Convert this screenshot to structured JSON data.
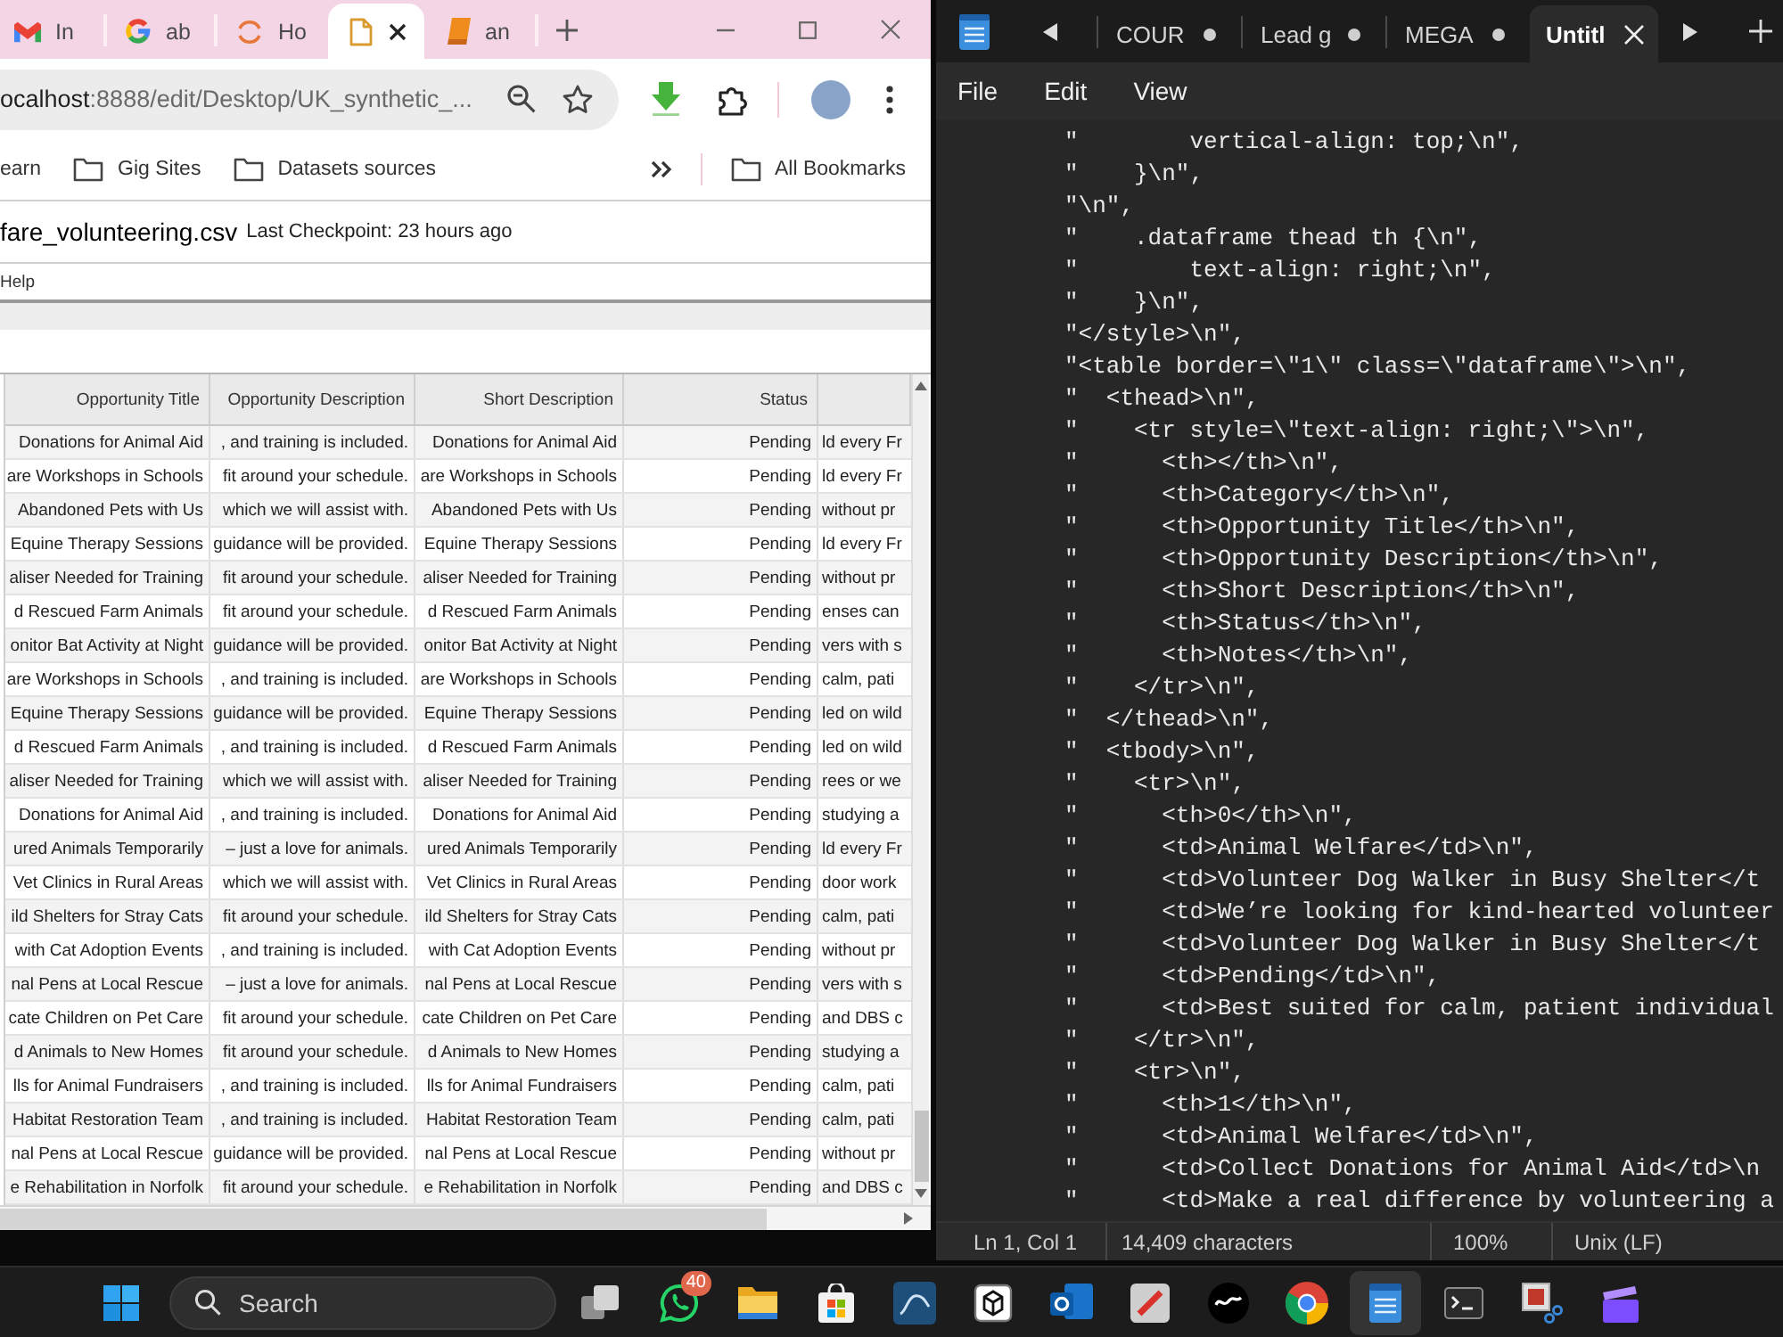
{
  "browser": {
    "tabs": [
      {
        "kind": "mail",
        "label": "In",
        "selected": false
      },
      {
        "kind": "segments",
        "label": "ab",
        "selected": false
      },
      {
        "kind": "ring",
        "label": "Ho",
        "selected": false
      },
      {
        "kind": "file",
        "selected": true
      },
      {
        "kind": "book",
        "label": "an",
        "selected": false
      }
    ],
    "url": {
      "host": "ocalhost",
      "path": ":8888/edit/Desktop/UK_synthetic_..."
    },
    "bookmarks": [
      {
        "kind": "plain",
        "label": "earn"
      },
      {
        "kind": "folder",
        "label": "Gig Sites"
      },
      {
        "kind": "folder",
        "label": "Datasets sources"
      }
    ],
    "all_bookmarks": "All Bookmarks"
  },
  "notebook": {
    "filename": "fare_volunteering.csv",
    "checkpoint": "Last Checkpoint: 23 hours ago",
    "menu": [
      "Help"
    ]
  },
  "table": {
    "columns": [
      "Opportunity Title",
      "Opportunity Description",
      "Short Description",
      "Status"
    ],
    "rows": [
      [
        "Donations for Animal Aid",
        ", and training is included.",
        "Donations for Animal Aid",
        "Pending",
        "ld every Fr"
      ],
      [
        "are Workshops in Schools",
        "fit around your schedule.",
        "are Workshops in Schools",
        "Pending",
        "ld every Fr"
      ],
      [
        "Abandoned Pets with Us",
        "which we will assist with.",
        "Abandoned Pets with Us",
        "Pending",
        "without pr"
      ],
      [
        "Equine Therapy Sessions",
        "guidance will be provided.",
        "Equine Therapy Sessions",
        "Pending",
        "ld every Fr"
      ],
      [
        "aliser Needed for Training",
        "fit around your schedule.",
        "aliser Needed for Training",
        "Pending",
        "without pr"
      ],
      [
        "d Rescued Farm Animals",
        "fit around your schedule.",
        "d Rescued Farm Animals",
        "Pending",
        "enses can"
      ],
      [
        "onitor Bat Activity at Night",
        "guidance will be provided.",
        "onitor Bat Activity at Night",
        "Pending",
        "vers with s"
      ],
      [
        "are Workshops in Schools",
        ", and training is included.",
        "are Workshops in Schools",
        "Pending",
        "calm, pati"
      ],
      [
        "Equine Therapy Sessions",
        "guidance will be provided.",
        "Equine Therapy Sessions",
        "Pending",
        "led on wild"
      ],
      [
        "d Rescued Farm Animals",
        ", and training is included.",
        "d Rescued Farm Animals",
        "Pending",
        "led on wild"
      ],
      [
        "aliser Needed for Training",
        "which we will assist with.",
        "aliser Needed for Training",
        "Pending",
        "rees or we"
      ],
      [
        "Donations for Animal Aid",
        ", and training is included.",
        "Donations for Animal Aid",
        "Pending",
        "studying a"
      ],
      [
        "ured Animals Temporarily",
        "– just a love for animals.",
        "ured Animals Temporarily",
        "Pending",
        "ld every Fr"
      ],
      [
        "Vet Clinics in Rural Areas",
        "which we will assist with.",
        "Vet Clinics in Rural Areas",
        "Pending",
        "door work"
      ],
      [
        "ild Shelters for Stray Cats",
        "fit around your schedule.",
        "ild Shelters for Stray Cats",
        "Pending",
        "calm, pati"
      ],
      [
        "with Cat Adoption Events",
        ", and training is included.",
        "with Cat Adoption Events",
        "Pending",
        "without pr"
      ],
      [
        "nal Pens at Local Rescue",
        "– just a love for animals.",
        "nal Pens at Local Rescue",
        "Pending",
        "vers with s"
      ],
      [
        "cate Children on Pet Care",
        "fit around your schedule.",
        "cate Children on Pet Care",
        "Pending",
        "and DBS c"
      ],
      [
        "d Animals to New Homes",
        "fit around your schedule.",
        "d Animals to New Homes",
        "Pending",
        "studying a"
      ],
      [
        "lls for Animal Fundraisers",
        ", and training is included.",
        "lls for Animal Fundraisers",
        "Pending",
        "calm, pati"
      ],
      [
        "Habitat Restoration Team",
        ", and training is included.",
        "Habitat Restoration Team",
        "Pending",
        "calm, pati"
      ],
      [
        "nal Pens at Local Rescue",
        "guidance will be provided.",
        "nal Pens at Local Rescue",
        "Pending",
        "without pr"
      ],
      [
        "e Rehabilitation in Norfolk",
        "fit around your schedule.",
        "e Rehabilitation in Norfolk",
        "Pending",
        "and DBS c"
      ]
    ]
  },
  "editor": {
    "tabs": [
      {
        "label": "COUR",
        "modified": true,
        "selected": false
      },
      {
        "label": "Lead g",
        "modified": true,
        "selected": false
      },
      {
        "label": "MEGA",
        "modified": true,
        "selected": false
      },
      {
        "label": "Untitl",
        "modified": false,
        "selected": true
      }
    ],
    "menu": [
      "File",
      "Edit",
      "View"
    ],
    "lines": [
      "\"        vertical-align: top;\\n\",",
      "\"    }\\n\",",
      "\"\\n\",",
      "\"    .dataframe thead th {\\n\",",
      "\"        text-align: right;\\n\",",
      "\"    }\\n\",",
      "\"</style>\\n\",",
      "\"<table border=\\\"1\\\" class=\\\"dataframe\\\">\\n\",",
      "\"  <thead>\\n\",",
      "\"    <tr style=\\\"text-align: right;\\\">\\n\",",
      "\"      <th></th>\\n\",",
      "\"      <th>Category</th>\\n\",",
      "\"      <th>Opportunity Title</th>\\n\",",
      "\"      <th>Opportunity Description</th>\\n\",",
      "\"      <th>Short Description</th>\\n\",",
      "\"      <th>Status</th>\\n\",",
      "\"      <th>Notes</th>\\n\",",
      "\"    </tr>\\n\",",
      "\"  </thead>\\n\",",
      "\"  <tbody>\\n\",",
      "\"    <tr>\\n\",",
      "\"      <th>0</th>\\n\",",
      "\"      <td>Animal Welfare</td>\\n\",",
      "\"      <td>Volunteer Dog Walker in Busy Shelter</t",
      "\"      <td>We’re looking for kind-hearted volunteer",
      "\"      <td>Volunteer Dog Walker in Busy Shelter</t",
      "\"      <td>Pending</td>\\n\",",
      "\"      <td>Best suited for calm, patient individual",
      "\"    </tr>\\n\",",
      "\"    <tr>\\n\",",
      "\"      <th>1</th>\\n\",",
      "\"      <td>Animal Welfare</td>\\n\",",
      "\"      <td>Collect Donations for Animal Aid</td>\\n",
      "\"      <td>Make a real difference by volunteering a"
    ],
    "status_bar": [
      "Ln 1, Col 1",
      "14,409 characters",
      "100%",
      "Unix (LF)"
    ]
  },
  "taskbar": {
    "search": {
      "placeholder": "Search"
    },
    "apps": [
      {
        "kind": "taskview",
        "selected": false
      },
      {
        "kind": "chat",
        "selected": false,
        "badge": "40"
      },
      {
        "kind": "folder",
        "selected": false
      },
      {
        "kind": "store",
        "selected": false
      },
      {
        "kind": "wave",
        "selected": false
      },
      {
        "kind": "cube",
        "selected": false
      },
      {
        "kind": "ring",
        "selected": false
      },
      {
        "kind": "slash",
        "selected": false
      },
      {
        "kind": "circle",
        "selected": false
      },
      {
        "kind": "wheel",
        "selected": false
      },
      {
        "kind": "notepad",
        "selected": true
      },
      {
        "kind": "terminal",
        "selected": false
      },
      {
        "kind": "snip",
        "selected": false
      },
      {
        "kind": "clapper",
        "selected": false
      }
    ]
  }
}
